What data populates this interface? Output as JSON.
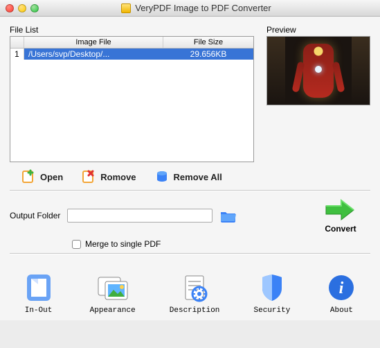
{
  "window": {
    "title": "VeryPDF Image to PDF Converter"
  },
  "filelist": {
    "label": "File List",
    "columns": {
      "num": " ",
      "file": "Image File",
      "size": "File Size"
    },
    "rows": [
      {
        "num": "1",
        "file": "/Users/svp/Desktop/...",
        "size": "29.656KB"
      }
    ]
  },
  "preview": {
    "label": "Preview"
  },
  "actions": {
    "open": "Open",
    "remove": "Romove",
    "remove_all": "Remove All"
  },
  "output": {
    "label": "Output Folder",
    "value": "",
    "merge_label": "Merge to single PDF"
  },
  "convert": {
    "label": "Convert"
  },
  "bottom": {
    "inout": "In-Out",
    "appearance": "Appearance",
    "description": "Description",
    "security": "Security",
    "about": "About"
  }
}
